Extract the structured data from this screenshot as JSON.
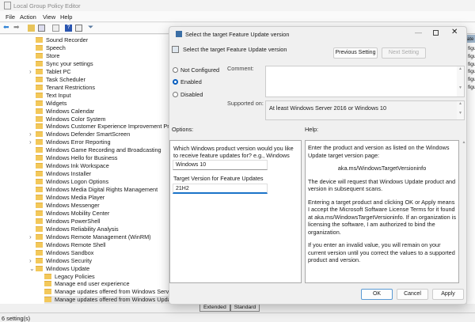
{
  "window": {
    "title": "Local Group Policy Editor",
    "menu": [
      "File",
      "Action",
      "View",
      "Help"
    ]
  },
  "tree": [
    {
      "label": "Sound Recorder",
      "indent": 1,
      "expander": ""
    },
    {
      "label": "Speech",
      "indent": 1,
      "expander": ""
    },
    {
      "label": "Store",
      "indent": 1,
      "expander": ""
    },
    {
      "label": "Sync your settings",
      "indent": 1,
      "expander": ""
    },
    {
      "label": "Tablet PC",
      "indent": 1,
      "expander": ">"
    },
    {
      "label": "Task Scheduler",
      "indent": 1,
      "expander": ""
    },
    {
      "label": "Tenant Restrictions",
      "indent": 1,
      "expander": ""
    },
    {
      "label": "Text Input",
      "indent": 1,
      "expander": ""
    },
    {
      "label": "Widgets",
      "indent": 1,
      "expander": ""
    },
    {
      "label": "Windows Calendar",
      "indent": 1,
      "expander": ""
    },
    {
      "label": "Windows Color System",
      "indent": 1,
      "expander": ""
    },
    {
      "label": "Windows Customer Experience Improvement Program",
      "indent": 1,
      "expander": ""
    },
    {
      "label": "Windows Defender SmartScreen",
      "indent": 1,
      "expander": ">"
    },
    {
      "label": "Windows Error Reporting",
      "indent": 1,
      "expander": ">"
    },
    {
      "label": "Windows Game Recording and Broadcasting",
      "indent": 1,
      "expander": ""
    },
    {
      "label": "Windows Hello for Business",
      "indent": 1,
      "expander": ""
    },
    {
      "label": "Windows Ink Workspace",
      "indent": 1,
      "expander": ""
    },
    {
      "label": "Windows Installer",
      "indent": 1,
      "expander": ""
    },
    {
      "label": "Windows Logon Options",
      "indent": 1,
      "expander": ""
    },
    {
      "label": "Windows Media Digital Rights Management",
      "indent": 1,
      "expander": ""
    },
    {
      "label": "Windows Media Player",
      "indent": 1,
      "expander": ""
    },
    {
      "label": "Windows Messenger",
      "indent": 1,
      "expander": ""
    },
    {
      "label": "Windows Mobility Center",
      "indent": 1,
      "expander": ""
    },
    {
      "label": "Windows PowerShell",
      "indent": 1,
      "expander": ""
    },
    {
      "label": "Windows Reliability Analysis",
      "indent": 1,
      "expander": ""
    },
    {
      "label": "Windows Remote Management (WinRM)",
      "indent": 1,
      "expander": ">"
    },
    {
      "label": "Windows Remote Shell",
      "indent": 1,
      "expander": ""
    },
    {
      "label": "Windows Sandbox",
      "indent": 1,
      "expander": ""
    },
    {
      "label": "Windows Security",
      "indent": 1,
      "expander": ">"
    },
    {
      "label": "Windows Update",
      "indent": 1,
      "expander": "v"
    },
    {
      "label": "Legacy Policies",
      "indent": 2,
      "expander": ""
    },
    {
      "label": "Manage end user experience",
      "indent": 2,
      "expander": ""
    },
    {
      "label": "Manage updates offered from Windows Server Update Service",
      "indent": 2,
      "expander": ""
    },
    {
      "label": "Manage updates offered from Windows Update",
      "indent": 2,
      "expander": "",
      "selected": true
    }
  ],
  "right_pane": {
    "header": "ate",
    "rows": [
      "figu",
      "figu",
      "figu",
      "figu",
      "figu",
      "figu"
    ]
  },
  "tabs": [
    "Extended",
    "Standard"
  ],
  "status": "6 setting(s)",
  "dialog": {
    "title": "Select the target Feature Update version",
    "setting_name": "Select the target Feature Update version",
    "prev_label": "Previous Setting",
    "next_label": "Next Setting",
    "radios": [
      "Not Configured",
      "Enabled",
      "Disabled"
    ],
    "selected_radio": "Enabled",
    "comment_label": "Comment:",
    "comment_value": "",
    "supported_label": "Supported on:",
    "supported_value": "At least Windows Server 2016 or Windows 10",
    "options_label": "Options:",
    "help_label": "Help:",
    "options": {
      "product_prompt": "Which Windows product version would you like to receive feature updates for? e.g., Windows 10",
      "product_value": "Windows 10",
      "target_label": "Target Version for Feature Updates",
      "target_value": "21H2"
    },
    "help": [
      "Enter the product and version as listed on the Windows Update target version page:",
      "aka.ms/WindowsTargetVersioninfo",
      "The device will request that Windows Update product and version in subsequent scans.",
      "Entering a target product and clicking OK or Apply means I accept the Microsoft Software License Terms for it found at aka.ms/WindowsTargetVersioninfo. If an organization is licensing the software, I am authorized to bind the organization.",
      "If you enter an invalid value, you will remain on your current version until you correct the values to a supported product and version."
    ],
    "ok": "OK",
    "cancel": "Cancel",
    "apply": "Apply"
  }
}
